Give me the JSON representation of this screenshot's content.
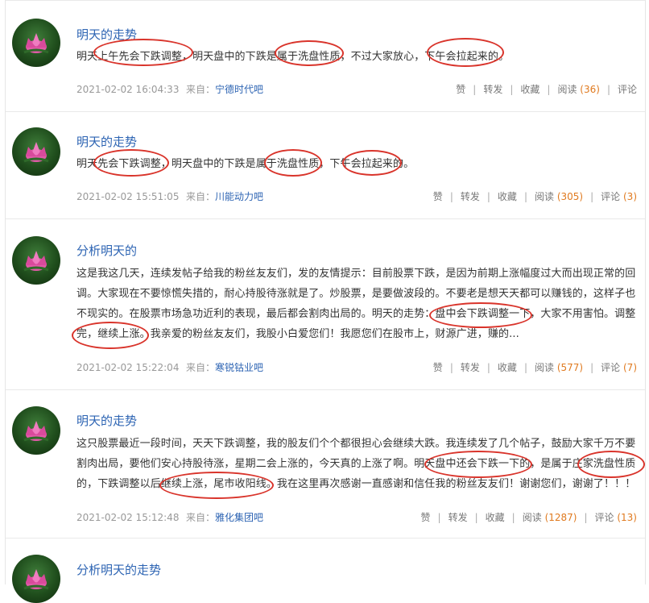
{
  "posts": [
    {
      "title": "明天的走势",
      "content": "明天上午先会下跌调整，明天盘中的下跌是属于洗盘性质，不过大家放心，下午会拉起来的。",
      "time": "2021-02-02 16:04:33",
      "from_label": "来自：",
      "source": "宁德时代吧",
      "like": "赞",
      "forward": "转发",
      "collect": "收藏",
      "read_label": "阅读",
      "read_count": "(36)",
      "comment_label": "评论",
      "comment_count": ""
    },
    {
      "title": "明天的走势",
      "content": "明天先会下跌调整，明天盘中的下跌是属于洗盘性质，下午会拉起来的。",
      "time": "2021-02-02 15:51:05",
      "from_label": "来自：",
      "source": "川能动力吧",
      "like": "赞",
      "forward": "转发",
      "collect": "收藏",
      "read_label": "阅读",
      "read_count": "(305)",
      "comment_label": "评论",
      "comment_count": "(3)"
    },
    {
      "title": "分析明天的",
      "content": "这是我这几天，连续发帖子给我的粉丝友友们，发的友情提示：目前股票下跌，是因为前期上涨幅度过大而出现正常的回调。大家现在不要惊慌失措的，耐心持股待涨就是了。炒股票，是要做波段的。不要老是想天天都可以赚钱的，这样子也不现实的。在股票市场急功近利的表现，最后都会割肉出局的。明天的走势：盘中会下跌调整一下，大家不用害怕。调整完，继续上涨。我亲爱的粉丝友友们，我股小白爱您们！我愿您们在股市上，财源广进，赚的...",
      "time": "2021-02-02 15:22:04",
      "from_label": "来自：",
      "source": "寒锐钴业吧",
      "like": "赞",
      "forward": "转发",
      "collect": "收藏",
      "read_label": "阅读",
      "read_count": "(577)",
      "comment_label": "评论",
      "comment_count": "(7)"
    },
    {
      "title": "明天的走势",
      "content": "这只股票最近一段时间，天天下跌调整，我的股友们个个都很担心会继续大跌。我连续发了几个帖子，鼓励大家千万不要割肉出局，要他们安心持股待涨，星期二会上涨的，今天真的上涨了啊。明天盘中还会下跌一下的，是属于庄家洗盘性质的，下跌调整以后继续上涨，尾市收阳线。我在这里再次感谢一直感谢和信任我的粉丝友友们！谢谢您们，谢谢了！！！",
      "time": "2021-02-02 15:12:48",
      "from_label": "来自：",
      "source": "雅化集团吧",
      "like": "赞",
      "forward": "转发",
      "collect": "收藏",
      "read_label": "阅读",
      "read_count": "(1287)",
      "comment_label": "评论",
      "comment_count": "(13)"
    },
    {
      "title": "分析明天的走势"
    }
  ],
  "colors": {
    "link": "#2d64b3",
    "count": "#e07a1f",
    "highlight_ring": "#d9342b"
  },
  "icons": {
    "avatar": "lotus-avatar-icon"
  }
}
